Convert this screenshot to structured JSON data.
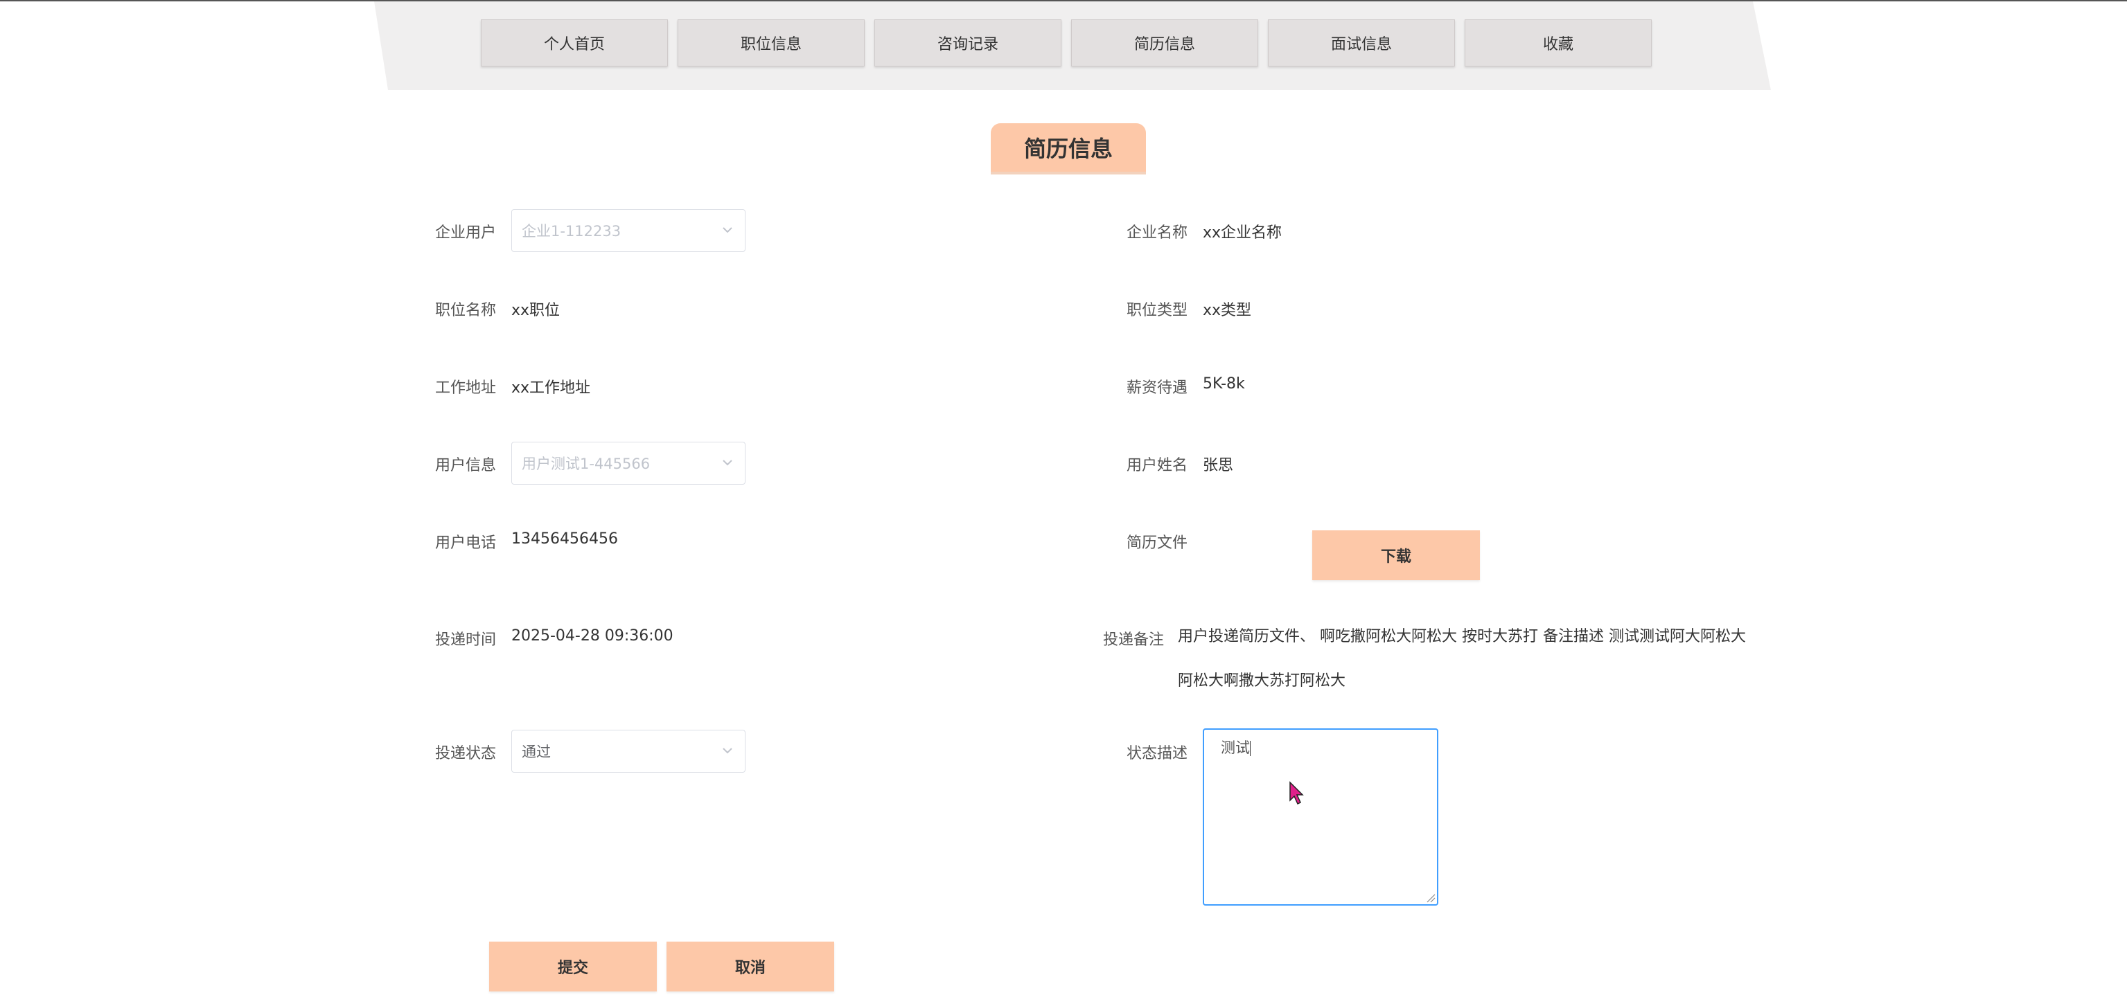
{
  "nav": {
    "tabs": [
      {
        "label": "个人首页"
      },
      {
        "label": "职位信息"
      },
      {
        "label": "咨询记录"
      },
      {
        "label": "简历信息"
      },
      {
        "label": "面试信息"
      },
      {
        "label": "收藏"
      }
    ]
  },
  "title": "简历信息",
  "form": {
    "company_user": {
      "label": "企业用户",
      "value": "企业1-112233"
    },
    "company_name": {
      "label": "企业名称",
      "value": "xx企业名称"
    },
    "job_name": {
      "label": "职位名称",
      "value": "xx职位"
    },
    "job_type": {
      "label": "职位类型",
      "value": "xx类型"
    },
    "work_address": {
      "label": "工作地址",
      "value": "xx工作地址"
    },
    "salary": {
      "label": "薪资待遇",
      "value": "5K-8k"
    },
    "user_info": {
      "label": "用户信息",
      "value": "用户测试1-445566"
    },
    "user_name": {
      "label": "用户姓名",
      "value": "张思"
    },
    "user_phone": {
      "label": "用户电话",
      "value": "13456456456"
    },
    "resume_file": {
      "label": "简历文件",
      "button": "下载"
    },
    "delivery_time": {
      "label": "投递时间",
      "value": "2025-04-28 09:36:00"
    },
    "delivery_remark": {
      "label": "投递备注",
      "value": "用户投递简历文件、 啊吃撒阿松大阿松大 按时大苏打 备注描述 测试测试阿大阿松大阿松大啊撒大苏打阿松大"
    },
    "delivery_status": {
      "label": "投递状态",
      "value": "通过"
    },
    "status_desc": {
      "label": "状态描述",
      "value": "测试"
    }
  },
  "actions": {
    "submit": "提交",
    "cancel": "取消"
  },
  "colors": {
    "accent": "#fdc8a8",
    "focus": "#409eff"
  }
}
